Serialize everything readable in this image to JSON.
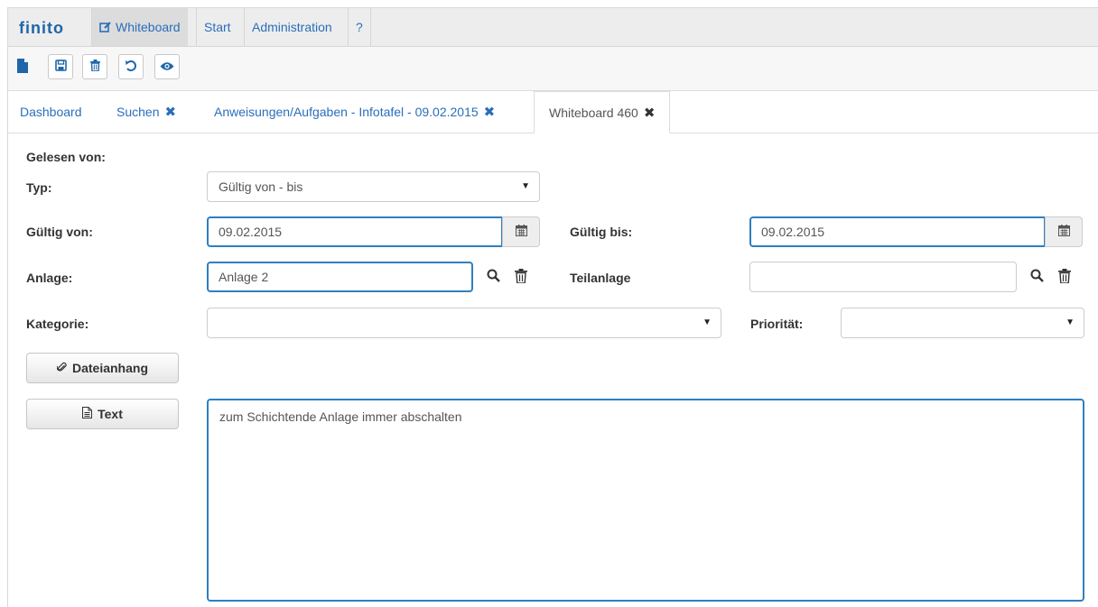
{
  "nav": {
    "brand": "finito",
    "tabs": [
      {
        "label": "Whiteboard",
        "icon": "edit-icon"
      },
      {
        "label": "Start"
      },
      {
        "label": "Administration"
      },
      {
        "label": "?"
      }
    ]
  },
  "toolbar": {
    "buttons": [
      "new-document-icon",
      "save-icon",
      "delete-icon",
      "undo-icon",
      "preview-icon"
    ]
  },
  "page_tabs": [
    {
      "label": "Dashboard",
      "closable": false
    },
    {
      "label": "Suchen",
      "closable": true
    },
    {
      "label": "Anweisungen/Aufgaben - Infotafel - 09.02.2015",
      "closable": true
    },
    {
      "label": "Whiteboard 460",
      "closable": true,
      "active": true
    }
  ],
  "close_glyph": "✖",
  "form": {
    "gelesen_label": "Gelesen von:",
    "typ_label": "Typ:",
    "typ_value": "Gültig von - bis",
    "gueltig_von_label": "Gültig von:",
    "gueltig_von_value": "09.02.2015",
    "gueltig_bis_label": "Gültig bis:",
    "gueltig_bis_value": "09.02.2015",
    "anlage_label": "Anlage:",
    "anlage_value": "Anlage 2",
    "teilanlage_label": "Teilanlage",
    "teilanlage_value": "",
    "kategorie_label": "Kategorie:",
    "kategorie_value": "",
    "prioritaet_label": "Priorität:",
    "prioritaet_value": "",
    "dateianhang_button": "Dateianhang",
    "text_button": "Text",
    "text_value": "zum Schichtende Anlage immer abschalten"
  },
  "colors": {
    "accent": "#2f7fc1",
    "link": "#2a6ebb",
    "brand": "#1e66a8"
  }
}
